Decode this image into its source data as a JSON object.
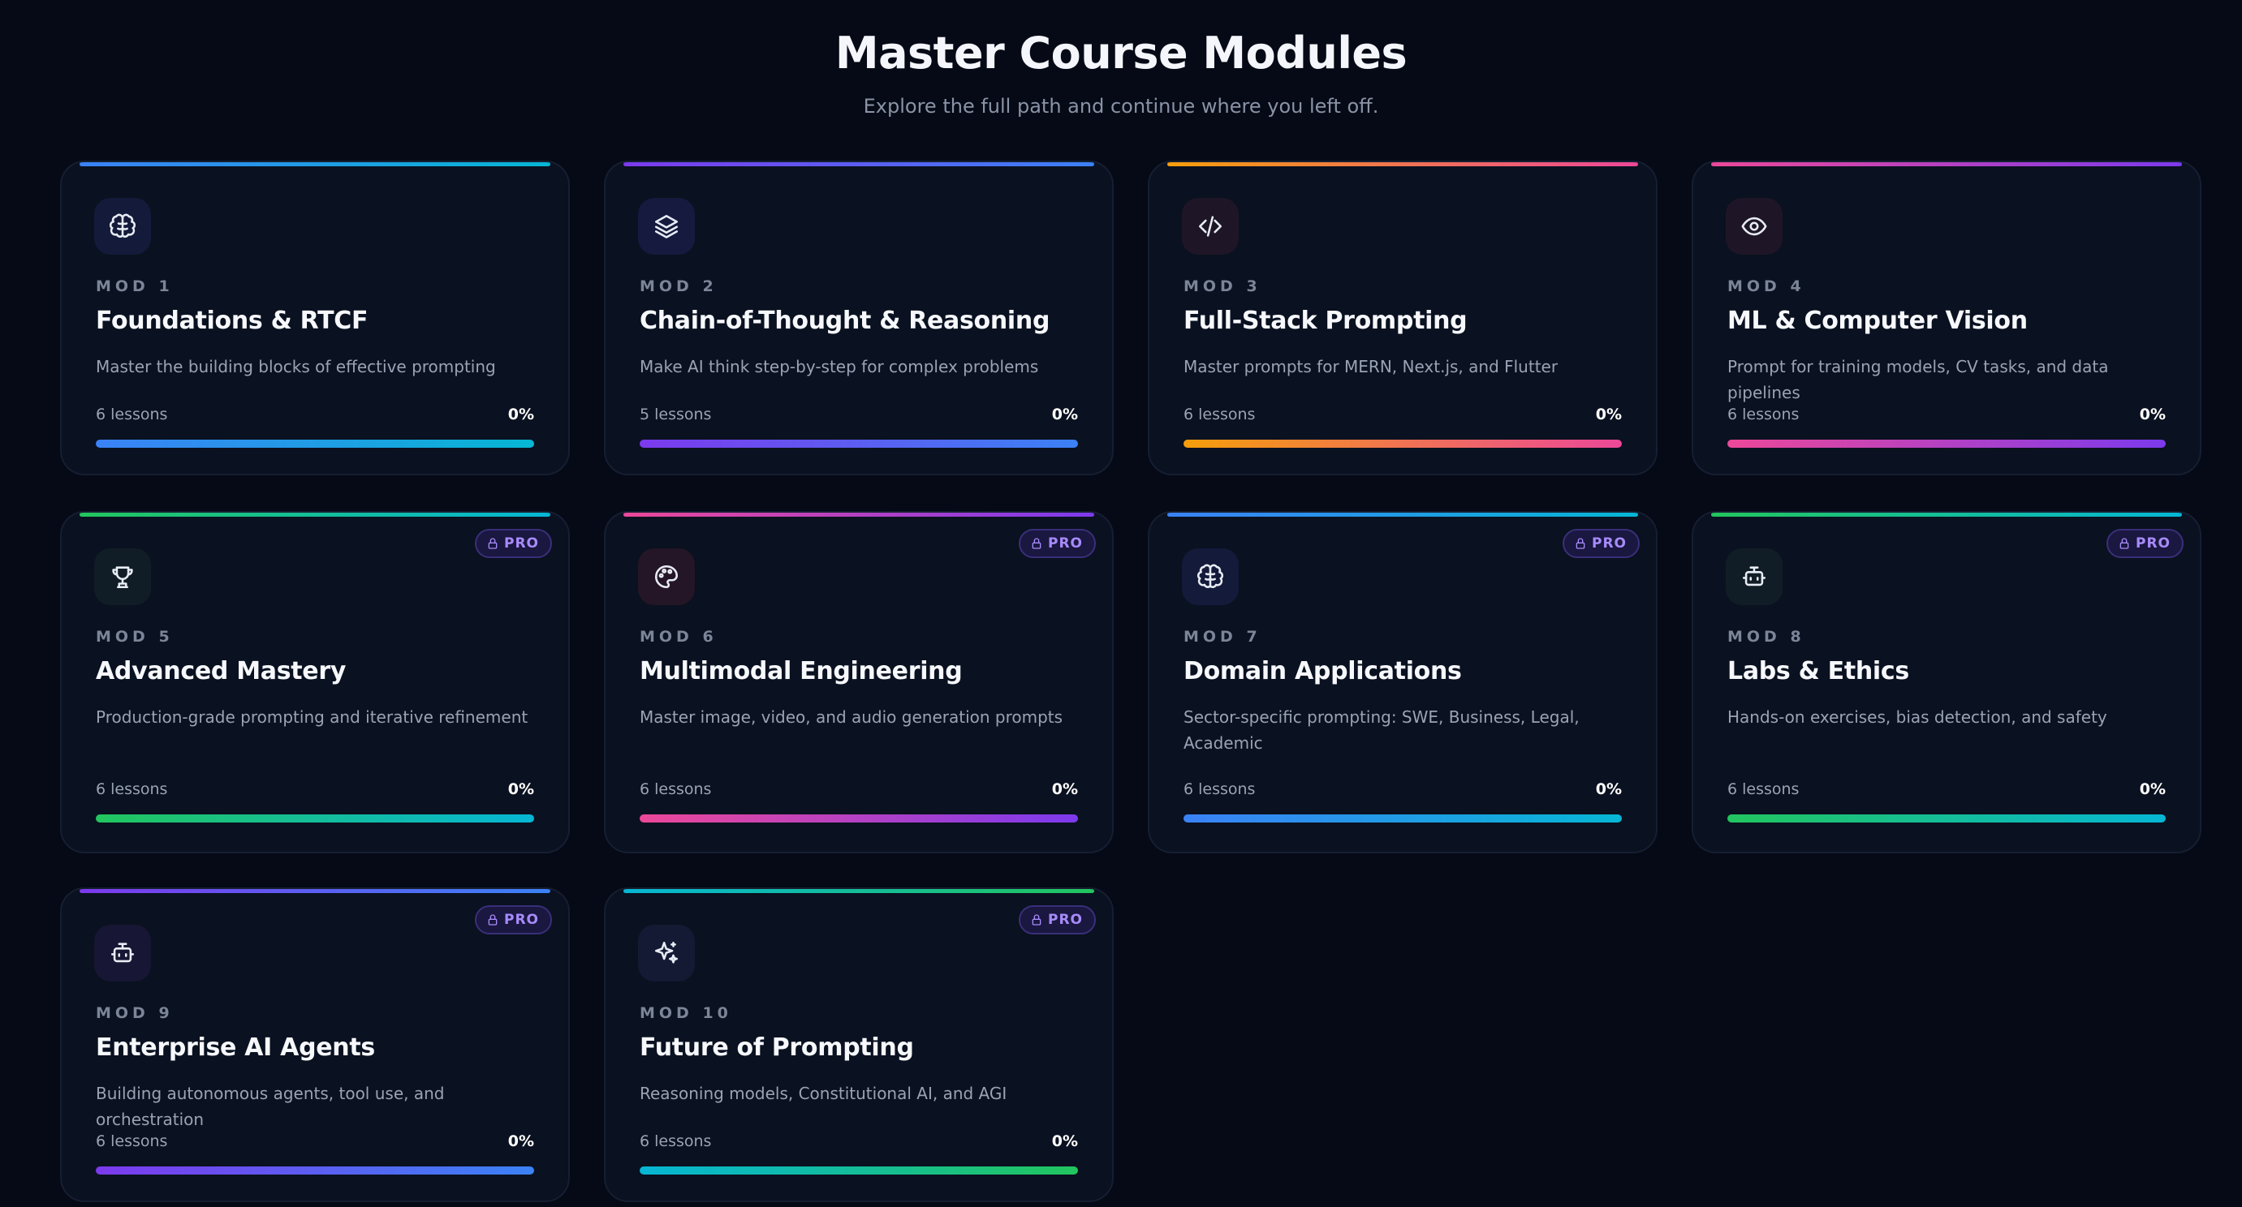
{
  "header": {
    "title": "Master Course Modules",
    "subtitle": "Explore the full path and continue where you left off."
  },
  "badge_label": "PRO",
  "modules": [
    {
      "mod": "MOD 1",
      "title": "Foundations & RTCF",
      "desc": "Master the building blocks of effective prompting",
      "lessons": "6 lessons",
      "percent": "0%",
      "progress": 0,
      "icon": "brain-icon",
      "pro": false,
      "colors": [
        "#3b82f6",
        "#06b6d4"
      ]
    },
    {
      "mod": "MOD 2",
      "title": "Chain-of-Thought & Reasoning",
      "desc": "Make AI think step-by-step for complex problems",
      "lessons": "5 lessons",
      "percent": "0%",
      "progress": 0,
      "icon": "layers-icon",
      "pro": false,
      "colors": [
        "#7c3aed",
        "#3b82f6"
      ]
    },
    {
      "mod": "MOD 3",
      "title": "Full-Stack Prompting",
      "desc": "Master prompts for MERN, Next.js, and Flutter",
      "lessons": "6 lessons",
      "percent": "0%",
      "progress": 0,
      "icon": "code-icon",
      "pro": false,
      "colors": [
        "#f59e0b",
        "#ec4899"
      ]
    },
    {
      "mod": "MOD 4",
      "title": "ML & Computer Vision",
      "desc": "Prompt for training models, CV tasks, and data pipelines",
      "lessons": "6 lessons",
      "percent": "0%",
      "progress": 0,
      "icon": "eye-icon",
      "pro": false,
      "colors": [
        "#ec4899",
        "#7c3aed"
      ]
    },
    {
      "mod": "MOD 5",
      "title": "Advanced Mastery",
      "desc": "Production-grade prompting and iterative refinement",
      "lessons": "6 lessons",
      "percent": "0%",
      "progress": 0,
      "icon": "trophy-icon",
      "pro": true,
      "colors": [
        "#22c55e",
        "#06b6d4"
      ]
    },
    {
      "mod": "MOD 6",
      "title": "Multimodal Engineering",
      "desc": "Master image, video, and audio generation prompts",
      "lessons": "6 lessons",
      "percent": "0%",
      "progress": 0,
      "icon": "palette-icon",
      "pro": true,
      "colors": [
        "#ec4899",
        "#7c3aed"
      ]
    },
    {
      "mod": "MOD 7",
      "title": "Domain Applications",
      "desc": "Sector-specific prompting: SWE, Business, Legal, Academic",
      "lessons": "6 lessons",
      "percent": "0%",
      "progress": 0,
      "icon": "brain-icon",
      "pro": true,
      "colors": [
        "#3b82f6",
        "#06b6d4"
      ]
    },
    {
      "mod": "MOD 8",
      "title": "Labs & Ethics",
      "desc": "Hands-on exercises, bias detection, and safety",
      "lessons": "6 lessons",
      "percent": "0%",
      "progress": 0,
      "icon": "bot-icon",
      "pro": true,
      "colors": [
        "#22c55e",
        "#06b6d4"
      ]
    },
    {
      "mod": "MOD 9",
      "title": "Enterprise AI Agents",
      "desc": "Building autonomous agents, tool use, and orchestration",
      "lessons": "6 lessons",
      "percent": "0%",
      "progress": 0,
      "icon": "bot-icon",
      "pro": true,
      "colors": [
        "#7c3aed",
        "#3b82f6"
      ]
    },
    {
      "mod": "MOD 10",
      "title": "Future of Prompting",
      "desc": "Reasoning models, Constitutional AI, and AGI",
      "lessons": "6 lessons",
      "percent": "0%",
      "progress": 0,
      "icon": "sparkles-icon",
      "pro": true,
      "colors": [
        "#06b6d4",
        "#22c55e"
      ]
    }
  ]
}
